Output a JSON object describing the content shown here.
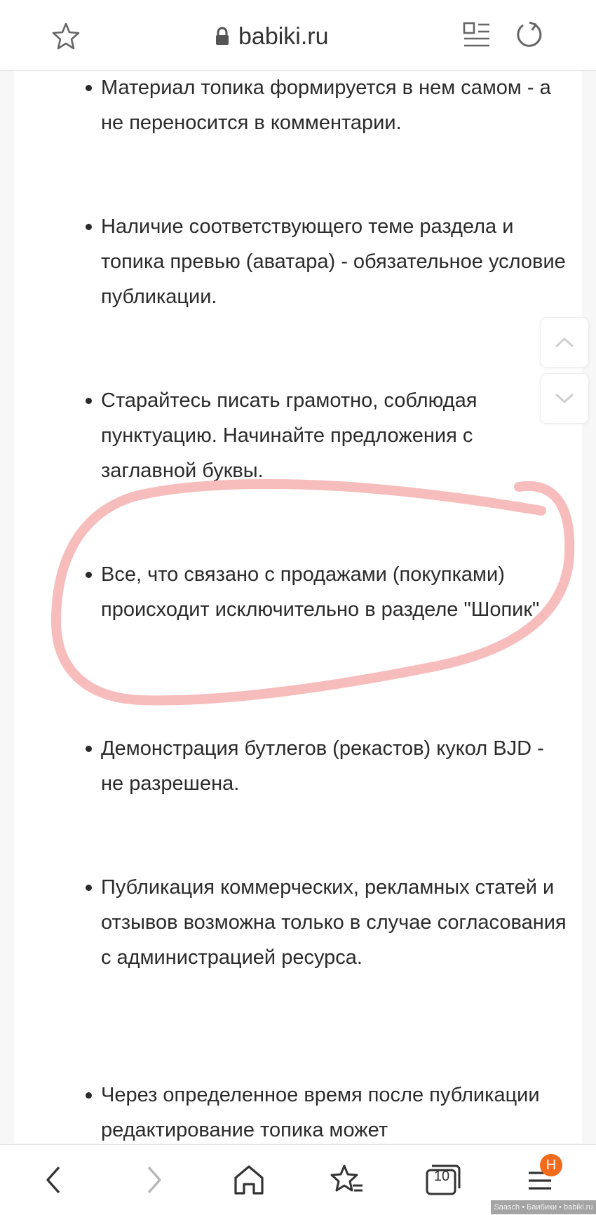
{
  "browser": {
    "url": "babiki.ru",
    "tab_count": "10",
    "menu_badge": "Н",
    "accent_color": "#f26a1b"
  },
  "rules": [
    "Материал топика формируется в нем самом - а не переносится в комментарии.",
    "Наличие соответствующего теме раздела и топика превью (аватара) - обязательное условие публикации.",
    "Старайтесь писать грамотно, соблюдая пунктуацию. Начинайте предложения с заглавной буквы.",
    "Все, что связано с продажами (покупками) происходит исключительно в разделе \"Шопик\".",
    "Демонстрация бутлегов (рекастов) кукол BJD - не разрешена.",
    "Публикация коммерческих, рекламных статей и отзывов возможна только в случае согласования с администрацией ресурса.",
    "Через определенное время после публикации редактирование топика может"
  ],
  "annotation": {
    "color": "#f7b9b9"
  },
  "watermark": "Saasch • Баибики • babiki.ru"
}
